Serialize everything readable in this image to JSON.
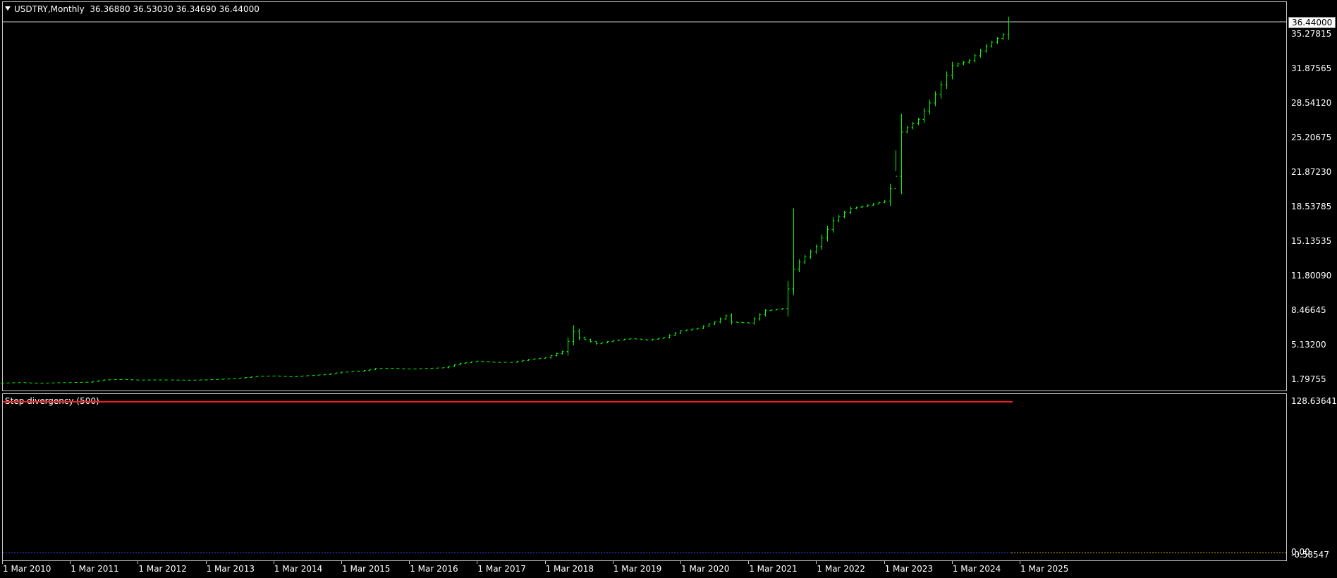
{
  "header": {
    "symbol_label": "USDTRY,Monthly",
    "ohlc_text": "36.36880 36.53030 36.34690 36.44000"
  },
  "colors": {
    "candle": "#00ff00",
    "indicator_line": "#ff1e1e",
    "zero_line": "#4040ff",
    "right_dotted": "#c8a000"
  },
  "price_axis": {
    "last_price": "36.44000",
    "ticks": [
      "35.27815",
      "31.87565",
      "28.54120",
      "25.20675",
      "21.87230",
      "18.53785",
      "15.13535",
      "11.80090",
      "8.46645",
      "5.13200",
      "1.79755"
    ]
  },
  "indicator": {
    "title": "Step divergency (500)",
    "axis_ticks": [
      "128.63641",
      "0.00",
      "-0.58547"
    ]
  },
  "time_axis": {
    "labels": [
      "1 Mar 2010",
      "1 Mar 2011",
      "1 Mar 2012",
      "1 Mar 2013",
      "1 Mar 2014",
      "1 Mar 2015",
      "1 Mar 2016",
      "1 Mar 2017",
      "1 Mar 2018",
      "1 Mar 2019",
      "1 Mar 2020",
      "1 Mar 2021",
      "1 Mar 2022",
      "1 Mar 2023",
      "1 Mar 2024",
      "1 Mar 2025"
    ]
  },
  "chart_data": {
    "type": "ohlc",
    "period": "Monthly",
    "ylim": [
      1.79755,
      36.44
    ],
    "series": [
      {
        "name": "USDTRY",
        "x": [
          "2010-03",
          "2010-06",
          "2010-09",
          "2010-12",
          "2011-03",
          "2011-06",
          "2011-09",
          "2011-12",
          "2012-03",
          "2012-06",
          "2012-09",
          "2012-12",
          "2013-03",
          "2013-06",
          "2013-09",
          "2013-12",
          "2014-03",
          "2014-06",
          "2014-09",
          "2014-12",
          "2015-03",
          "2015-06",
          "2015-09",
          "2015-12",
          "2016-03",
          "2016-06",
          "2016-09",
          "2016-12",
          "2017-03",
          "2017-06",
          "2017-09",
          "2017-12",
          "2018-03",
          "2018-06",
          "2018-08",
          "2018-09",
          "2018-12",
          "2019-03",
          "2019-06",
          "2019-09",
          "2019-12",
          "2020-03",
          "2020-06",
          "2020-09",
          "2020-11",
          "2020-12",
          "2021-03",
          "2021-06",
          "2021-09",
          "2021-11",
          "2021-12",
          "2022-03",
          "2022-06",
          "2022-09",
          "2022-12",
          "2023-03",
          "2023-05",
          "2023-06",
          "2023-09",
          "2023-12",
          "2024-03",
          "2024-06",
          "2024-09",
          "2024-12",
          "2025-01"
        ],
        "values": [
          1.5,
          1.55,
          1.47,
          1.52,
          1.55,
          1.58,
          1.8,
          1.85,
          1.78,
          1.8,
          1.79,
          1.77,
          1.81,
          1.88,
          1.98,
          2.15,
          2.18,
          2.1,
          2.22,
          2.32,
          2.55,
          2.62,
          2.9,
          2.91,
          2.85,
          2.91,
          2.98,
          3.4,
          3.62,
          3.5,
          3.5,
          3.78,
          3.95,
          4.55,
          6.5,
          5.9,
          5.3,
          5.6,
          5.8,
          5.65,
          5.9,
          6.55,
          6.8,
          7.4,
          8.0,
          7.4,
          7.3,
          8.5,
          8.7,
          12.5,
          13.2,
          14.7,
          17.2,
          18.4,
          18.7,
          19.1,
          21.5,
          25.8,
          27.0,
          29.4,
          32.2,
          32.7,
          34.1,
          35.2,
          36.44
        ]
      }
    ],
    "indicator_series": {
      "name": "Step divergency (500)",
      "value": 128.63641,
      "zero": 0.0
    },
    "x_tick_labels": [
      "1 Mar 2010",
      "1 Mar 2011",
      "1 Mar 2012",
      "1 Mar 2013",
      "1 Mar 2014",
      "1 Mar 2015",
      "1 Mar 2016",
      "1 Mar 2017",
      "1 Mar 2018",
      "1 Mar 2019",
      "1 Mar 2020",
      "1 Mar 2021",
      "1 Mar 2022",
      "1 Mar 2023",
      "1 Mar 2024",
      "1 Mar 2025"
    ],
    "grid": false
  }
}
